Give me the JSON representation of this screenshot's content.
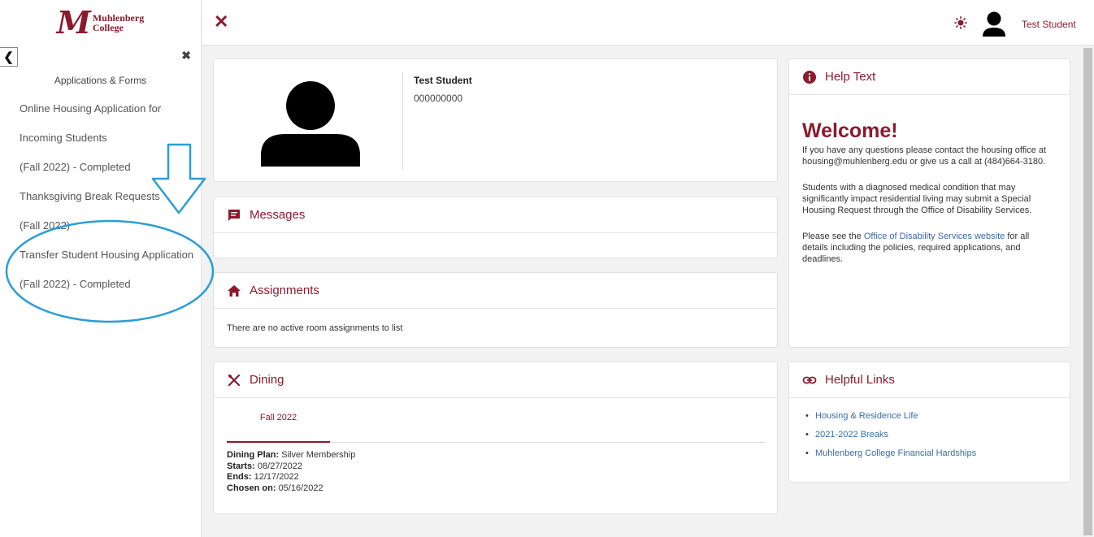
{
  "app": {
    "logo_line1": "Muhlenberg",
    "logo_line2": "College",
    "logo_mark": "M",
    "brand_color": "#8b1a2e"
  },
  "sidebar": {
    "heading": "Applications & Forms",
    "items": [
      {
        "label": "Online Housing Application for"
      },
      {
        "label": "Incoming Students"
      },
      {
        "label": "(Fall 2022) - Completed"
      },
      {
        "label": "Thanksgiving Break Requests"
      },
      {
        "label": "(Fall 2022)"
      },
      {
        "label": "Transfer Student Housing Application"
      },
      {
        "label": "(Fall 2022) - Completed"
      }
    ]
  },
  "topbar": {
    "user_name": "Test Student"
  },
  "profile": {
    "name": "Test Student",
    "id": "000000000"
  },
  "messages": {
    "title": "Messages"
  },
  "assignments": {
    "title": "Assignments",
    "empty_text": "There are no active room assignments to list"
  },
  "dining": {
    "title": "Dining",
    "tab": "Fall 2022",
    "plan_label": "Dining Plan:",
    "plan_value": "Silver Membership",
    "starts_label": "Starts:",
    "starts_value": "08/27/2022",
    "ends_label": "Ends:",
    "ends_value": "12/17/2022",
    "chosen_label": "Chosen on:",
    "chosen_value": "05/16/2022"
  },
  "help": {
    "title": "Help Text",
    "welcome": "Welcome!",
    "para1": "If you have any questions please contact the housing office at housing@muhlenberg.edu or give us a call at (484)664-3180.",
    "para2": "Students with a diagnosed medical condition that may significantly impact residential living may submit a Special Housing Request through the Office of Disability Services.",
    "para3_before": "Please see the ",
    "para3_link": "Office of Disability Services website",
    "para3_after": " for all details including the policies, required applications, and deadlines."
  },
  "helpful_links": {
    "title": "Helpful Links",
    "items": [
      {
        "label": "Housing & Residence Life"
      },
      {
        "label": "2021-2022 Breaks"
      },
      {
        "label": "Muhlenberg College Financial Hardships"
      }
    ]
  },
  "annotation": {
    "color": "#2a9fd6"
  }
}
